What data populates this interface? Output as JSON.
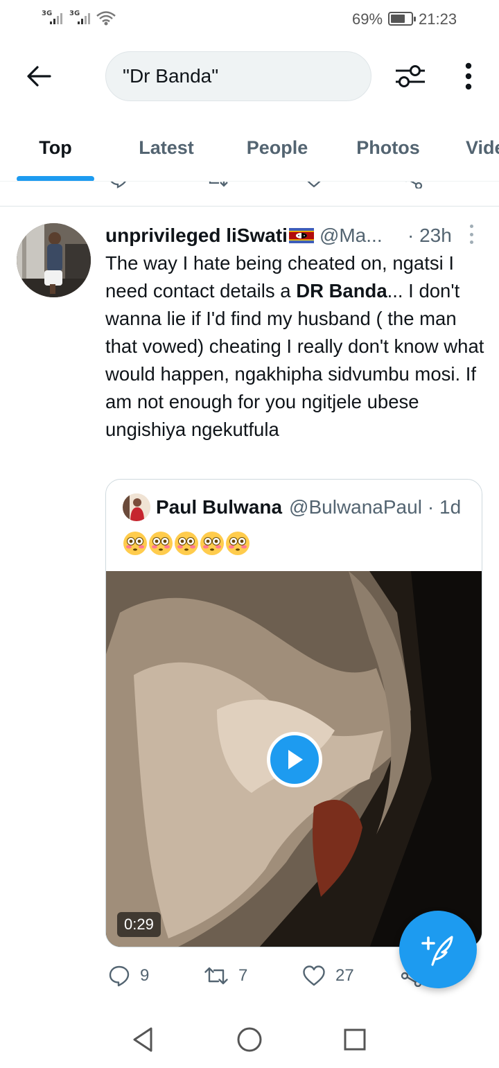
{
  "status_bar": {
    "signal_1": "3G",
    "signal_2": "3G",
    "battery_percent": "69%",
    "time": "21:23"
  },
  "search": {
    "query": "\"Dr Banda\""
  },
  "tabs": [
    {
      "label": "Top",
      "active": true
    },
    {
      "label": "Latest",
      "active": false
    },
    {
      "label": "People",
      "active": false
    },
    {
      "label": "Photos",
      "active": false
    },
    {
      "label": "Videos",
      "active": false
    }
  ],
  "tweet": {
    "display_name": "unprivileged liSwati",
    "handle": "@Ma...",
    "time": "· 23h",
    "text_before": "The way I hate being cheated on, ngatsi I need contact details a ",
    "text_bold": "DR Banda",
    "text_after": "... I don't wanna lie if I'd find my husband ( the man that vowed) cheating I really don't know what would happen, ngakhipha sidvumbu mosi. If am not enough for you ngitjele ubese ungishiya ngekutfula",
    "quoted": {
      "display_name": "Paul Bulwana",
      "handle": "@BulwanaPaul",
      "time": "· 1d",
      "emoji_count": 5,
      "video_duration": "0:29"
    },
    "stats": {
      "replies": "9",
      "retweets": "7",
      "likes": "27"
    }
  },
  "colors": {
    "accent": "#1d9bf0",
    "text_primary": "#0f1419",
    "text_secondary": "#536471"
  }
}
